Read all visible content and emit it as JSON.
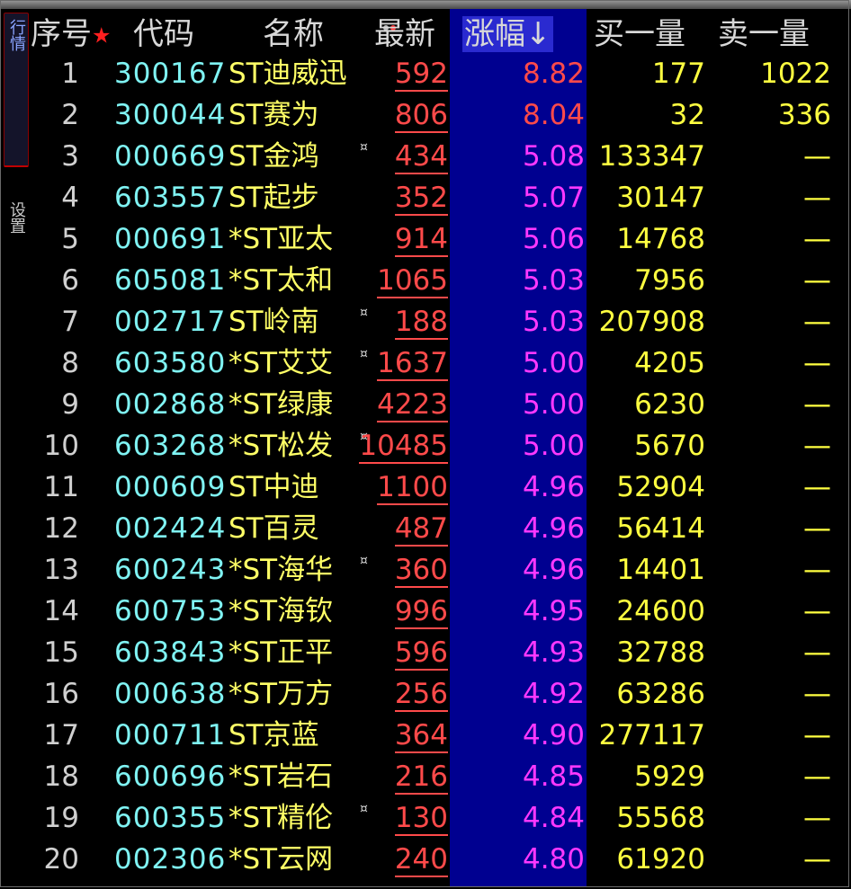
{
  "sidebar": {
    "tab_quotes": "行情",
    "tab_settings": "设置"
  },
  "header": {
    "index": "序号",
    "index_star": "★",
    "code": "代码",
    "name": "名称",
    "price": "最新",
    "change": "涨幅↓",
    "bid_vol": "买一量",
    "ask_vol": "卖一量"
  },
  "colors": {
    "highlight_column": "#000090",
    "up_red": "#ff4a4a",
    "magenta": "#ff38ff",
    "code_cyan": "#7ff3f3",
    "name_yellow": "#ffff66"
  },
  "rows": [
    {
      "idx": "1",
      "code": "300167",
      "name": "ST迪威迅",
      "mark": "",
      "price": "592",
      "change": "8.82",
      "change_color": "red",
      "bid": "177",
      "ask": "1022"
    },
    {
      "idx": "2",
      "code": "300044",
      "name": "ST赛为",
      "mark": "",
      "price": "806",
      "change": "8.04",
      "change_color": "red",
      "bid": "32",
      "ask": "336"
    },
    {
      "idx": "3",
      "code": "000669",
      "name": "ST金鸿",
      "mark": "¤",
      "price": "434",
      "change": "5.08",
      "change_color": "mag",
      "bid": "133347",
      "ask": "—"
    },
    {
      "idx": "4",
      "code": "603557",
      "name": "ST起步",
      "mark": "",
      "price": "352",
      "change": "5.07",
      "change_color": "mag",
      "bid": "30147",
      "ask": "—"
    },
    {
      "idx": "5",
      "code": "000691",
      "name": "*ST亚太",
      "mark": "",
      "price": "914",
      "change": "5.06",
      "change_color": "mag",
      "bid": "14768",
      "ask": "—"
    },
    {
      "idx": "6",
      "code": "605081",
      "name": "*ST太和",
      "mark": "",
      "price": "1065",
      "change": "5.03",
      "change_color": "mag",
      "bid": "7956",
      "ask": "—"
    },
    {
      "idx": "7",
      "code": "002717",
      "name": "ST岭南",
      "mark": "¤",
      "price": "188",
      "change": "5.03",
      "change_color": "mag",
      "bid": "207908",
      "ask": "—"
    },
    {
      "idx": "8",
      "code": "603580",
      "name": "*ST艾艾",
      "mark": "¤",
      "price": "1637",
      "change": "5.00",
      "change_color": "mag",
      "bid": "4205",
      "ask": "—"
    },
    {
      "idx": "9",
      "code": "002868",
      "name": "*ST绿康",
      "mark": "",
      "price": "4223",
      "change": "5.00",
      "change_color": "mag",
      "bid": "6230",
      "ask": "—"
    },
    {
      "idx": "10",
      "code": "603268",
      "name": "*ST松发",
      "mark": "¤",
      "price": "10485",
      "change": "5.00",
      "change_color": "mag",
      "bid": "5670",
      "ask": "—"
    },
    {
      "idx": "11",
      "code": "000609",
      "name": "ST中迪",
      "mark": "",
      "price": "1100",
      "change": "4.96",
      "change_color": "mag",
      "bid": "52904",
      "ask": "—"
    },
    {
      "idx": "12",
      "code": "002424",
      "name": "ST百灵",
      "mark": "",
      "price": "487",
      "change": "4.96",
      "change_color": "mag",
      "bid": "56414",
      "ask": "—"
    },
    {
      "idx": "13",
      "code": "600243",
      "name": "*ST海华",
      "mark": "¤",
      "price": "360",
      "change": "4.96",
      "change_color": "mag",
      "bid": "14401",
      "ask": "—"
    },
    {
      "idx": "14",
      "code": "600753",
      "name": "*ST海钦",
      "mark": "",
      "price": "996",
      "change": "4.95",
      "change_color": "mag",
      "bid": "24600",
      "ask": "—"
    },
    {
      "idx": "15",
      "code": "603843",
      "name": "*ST正平",
      "mark": "",
      "price": "596",
      "change": "4.93",
      "change_color": "mag",
      "bid": "32788",
      "ask": "—"
    },
    {
      "idx": "16",
      "code": "000638",
      "name": "*ST万方",
      "mark": "",
      "price": "256",
      "change": "4.92",
      "change_color": "mag",
      "bid": "63286",
      "ask": "—"
    },
    {
      "idx": "17",
      "code": "000711",
      "name": "ST京蓝",
      "mark": "",
      "price": "364",
      "change": "4.90",
      "change_color": "mag",
      "bid": "277117",
      "ask": "—"
    },
    {
      "idx": "18",
      "code": "600696",
      "name": "*ST岩石",
      "mark": "",
      "price": "216",
      "change": "4.85",
      "change_color": "mag",
      "bid": "5929",
      "ask": "—"
    },
    {
      "idx": "19",
      "code": "600355",
      "name": "*ST精伦",
      "mark": "¤",
      "price": "130",
      "change": "4.84",
      "change_color": "mag",
      "bid": "55568",
      "ask": "—"
    },
    {
      "idx": "20",
      "code": "002306",
      "name": "*ST云网",
      "mark": "",
      "price": "240",
      "change": "4.80",
      "change_color": "mag",
      "bid": "61920",
      "ask": "—"
    }
  ]
}
